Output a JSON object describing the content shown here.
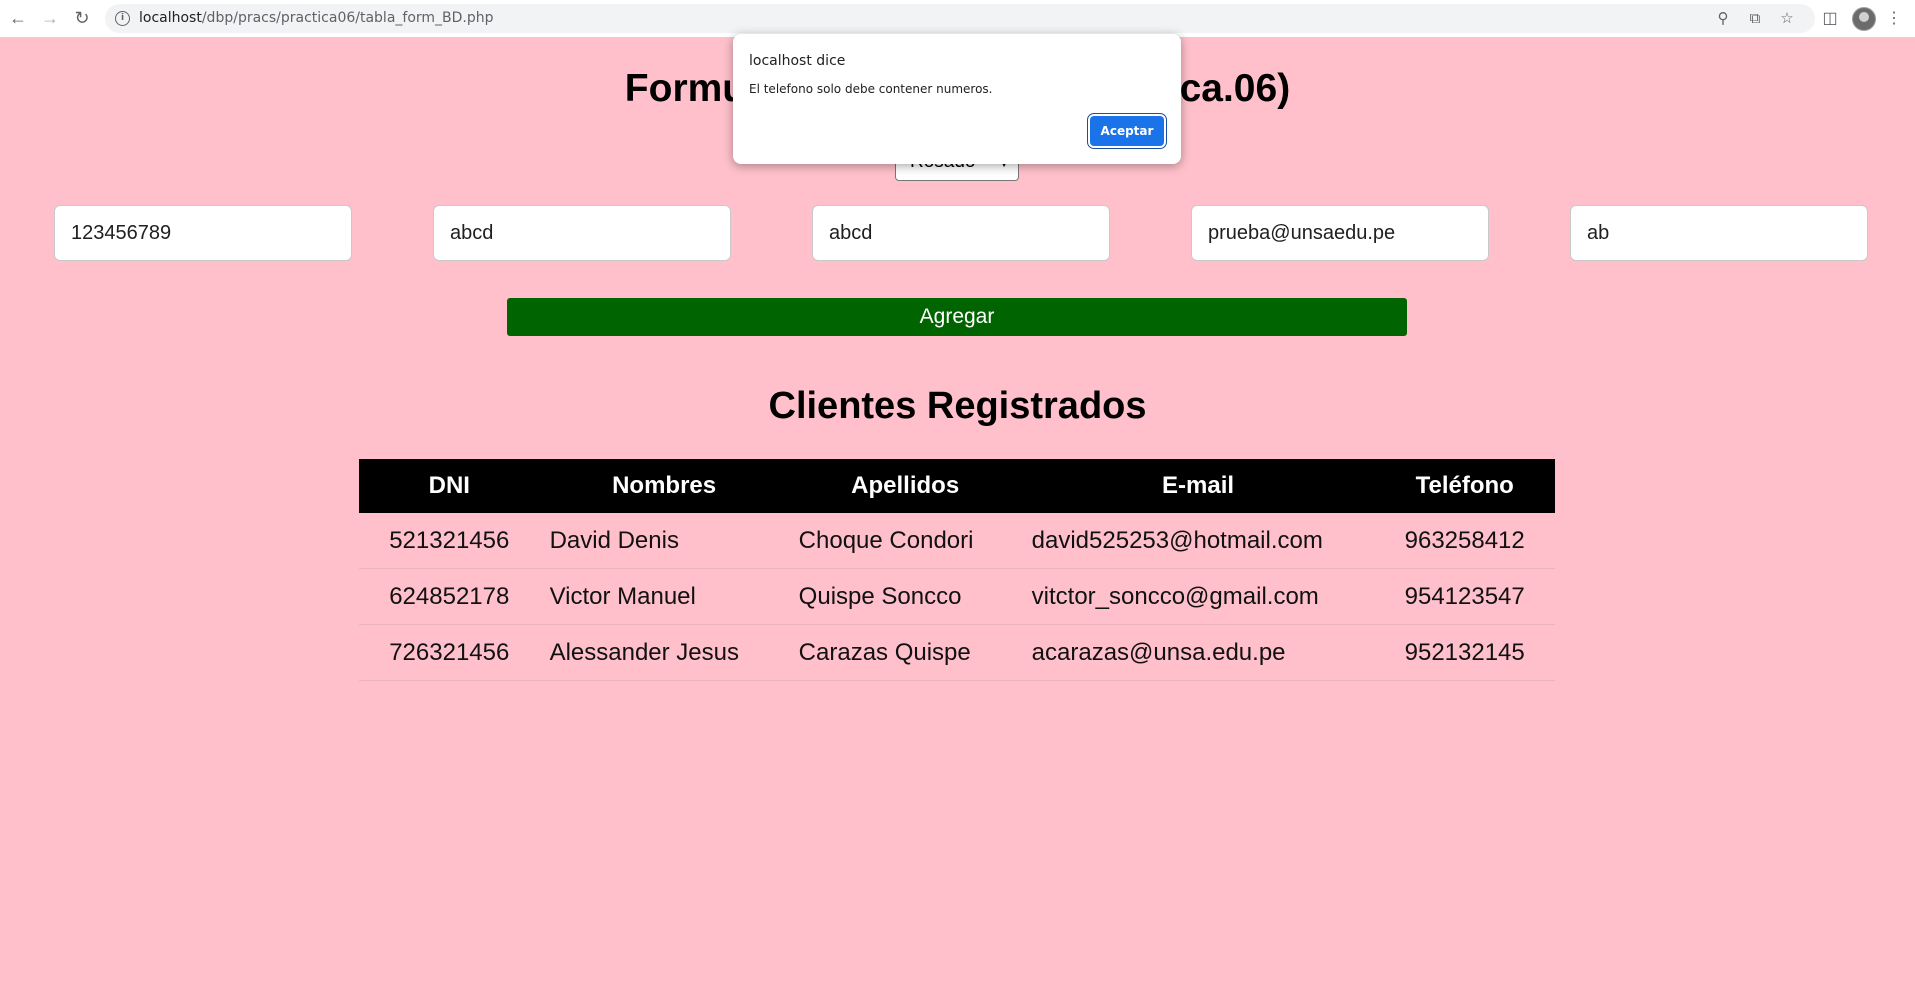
{
  "browser": {
    "url_host": "localhost",
    "url_path": "/dbp/pracs/practica06/tabla_form_BD.php"
  },
  "page": {
    "title": "Formulario de Clientes (Practica.06)",
    "color_select": {
      "selected": "Rosado"
    },
    "fields": [
      "123456789",
      "abcd",
      "abcd",
      "prueba@unsaedu.pe",
      "ab"
    ],
    "add_button": "Agregar",
    "section_title": "Clientes Registrados",
    "table": {
      "headers": [
        "DNI",
        "Nombres",
        "Apellidos",
        "E-mail",
        "Teléfono"
      ],
      "rows": [
        [
          "521321456",
          "David Denis",
          "Choque Condori",
          "david525253@hotmail.com",
          "963258412"
        ],
        [
          "624852178",
          "Victor Manuel",
          "Quispe Soncco",
          "vitctor_soncco@gmail.com",
          "954123547"
        ],
        [
          "726321456",
          "Alessander Jesus",
          "Carazas Quispe",
          "acarazas@unsa.edu.pe",
          "952132145"
        ]
      ]
    }
  },
  "dialog": {
    "title": "localhost dice",
    "message": "El telefono solo debe contener numeros.",
    "ok_label": "Aceptar"
  },
  "colors": {
    "page_bg": "#ffc0cb",
    "button_green": "#006400",
    "table_header": "#000000",
    "dialog_button": "#1a73e8"
  },
  "icons": [
    "back-arrow-icon",
    "forward-arrow-icon",
    "reload-icon",
    "info-icon",
    "zoom-icon",
    "share-icon",
    "star-icon",
    "side-panel-icon",
    "avatar",
    "kebab-menu-icon",
    "chevron-down-icon"
  ]
}
